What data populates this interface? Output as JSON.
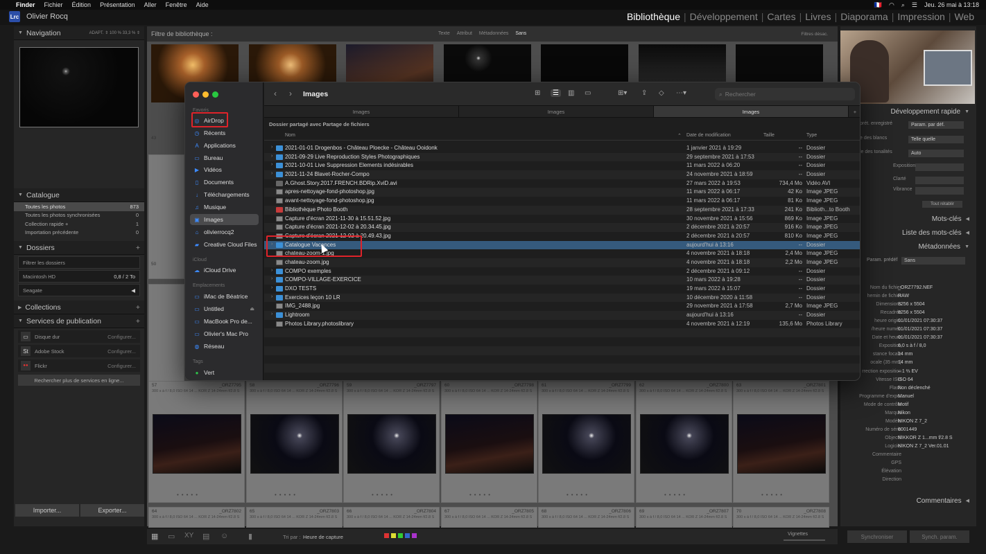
{
  "menubar": {
    "app": "Finder",
    "items": [
      "Fichier",
      "Édition",
      "Présentation",
      "Aller",
      "Fenêtre",
      "Aide"
    ],
    "flag": "🇫🇷",
    "clock": "Jeu. 26 mai à 13:18"
  },
  "lr": {
    "logo": "Lrc",
    "owner": "Olivier Rocq",
    "modules": [
      "Bibliothèque",
      "Développement",
      "Cartes",
      "Livres",
      "Diaporama",
      "Impression",
      "Web"
    ],
    "filter": {
      "title": "Filtre de bibliothèque :",
      "tabs": [
        "Texte",
        "Attribut",
        "Métadonnées",
        "Sans"
      ],
      "off": "Filtres désac."
    }
  },
  "left": {
    "navigation": {
      "title": "Navigation",
      "opts": "ADAPT. ⇕   100 %   33,3 % ⇕"
    },
    "catalogue": {
      "title": "Catalogue",
      "rows": [
        {
          "label": "Toutes les photos",
          "count": "873"
        },
        {
          "label": "Toutes les photos synchronisées",
          "count": "0"
        },
        {
          "label": "Collection rapide +",
          "count": "1"
        },
        {
          "label": "Importation précédente",
          "count": "0"
        }
      ]
    },
    "dossiers": {
      "title": "Dossiers",
      "search": "Filtrer les dossiers",
      "disks": [
        {
          "label": "Macintosh HD",
          "info": "0,8 / 2 To"
        },
        {
          "label": "Seagate",
          "info": ""
        }
      ]
    },
    "collections": {
      "title": "Collections"
    },
    "services": {
      "title": "Services de publication",
      "items": [
        {
          "icon": "▭",
          "label": "Disque dur",
          "cfg": "Configurer..."
        },
        {
          "icon": "St",
          "label": "Adobe Stock",
          "cfg": "Configurer..."
        },
        {
          "icon": "●●",
          "label": "Flickr",
          "cfg": "Configurer..."
        }
      ],
      "more": "Rechercher plus de services en ligne..."
    },
    "import_label": "Importer...",
    "export_label": "Exporter..."
  },
  "grid": {
    "row1_num": [
      "43",
      "",
      "",
      "",
      "",
      "",
      ""
    ],
    "row2": [
      {
        "num": "57",
        "file": "_ORZ7795"
      },
      {
        "num": "58",
        "file": "_ORZ7796"
      },
      {
        "num": "59",
        "file": "_ORZ7797"
      },
      {
        "num": "60",
        "file": "_ORZ7798"
      },
      {
        "num": "61",
        "file": "_ORZ7799"
      },
      {
        "num": "62",
        "file": "_ORZ7800"
      },
      {
        "num": "63",
        "file": "_ORZ7801"
      }
    ],
    "row3": [
      {
        "num": "64",
        "file": "_ORZ7802"
      },
      {
        "num": "65",
        "file": "_ORZ7803"
      },
      {
        "num": "66",
        "file": "_ORZ7804"
      },
      {
        "num": "67",
        "file": "_ORZ7805"
      },
      {
        "num": "68",
        "file": "_ORZ7806"
      },
      {
        "num": "69",
        "file": "_ORZ7807"
      },
      {
        "num": "70",
        "file": "_ORZ7808"
      }
    ],
    "meta": "300 s à f / 8,0 ISO 64  14 ... KOR Z 14-24mm f/2.8 S",
    "side_nums": [
      "50"
    ],
    "sort_label": "Tri par :",
    "sort_value": "Heure de capture",
    "vignettes": "Vignettes"
  },
  "right": {
    "quick": {
      "title": "Développement rapide",
      "rows": [
        {
          "k": "prét. enregistré",
          "v": "Param. par déf."
        },
        {
          "k": "e des blancs",
          "v": "Telle quelle"
        },
        {
          "k": "le des tonalités",
          "v": "Auto"
        },
        {
          "k": "Exposition",
          "v": ""
        },
        {
          "k": "Clarté",
          "v": ""
        },
        {
          "k": "Vibrance",
          "v": ""
        }
      ],
      "auto": "Tout rétablir"
    },
    "keywords": "Mots-clés",
    "keyword_list": "Liste des mots-clés",
    "metadata": {
      "title": "Métadonnées",
      "preset_label": "Param. prédéf",
      "preset": "Sans",
      "rows": [
        {
          "k": "Nom du fichier",
          "v": "_ORZ7792.NEF"
        },
        {
          "k": "hemin de fichier",
          "v": "RAW"
        },
        {
          "k": "Dimensions",
          "v": "8256 x 5504"
        },
        {
          "k": "Recadrée",
          "v": "8256 x 5504"
        },
        {
          "k": "heure origin.",
          "v": "01/01/2021 07:30:37"
        },
        {
          "k": "/heure numér.",
          "v": "01/01/2021 07:30:37"
        },
        {
          "k": "Date et heure",
          "v": "01/01/2021 07:30:37"
        },
        {
          "k": "Exposition",
          "v": "6,0 s à f / 8,0"
        },
        {
          "k": "stance focale",
          "v": "14 mm"
        },
        {
          "k": "ocale (35 mm)",
          "v": "14 mm"
        },
        {
          "k": "rrection exposition",
          "v": "– 1 ⅔ EV"
        },
        {
          "k": "Vitesse ISO",
          "v": "ISO 64"
        },
        {
          "k": "Flash",
          "v": "Non déclenché"
        },
        {
          "k": "Programme d'expo.",
          "v": "Manuel"
        },
        {
          "k": "Mode de contrôle",
          "v": "Motif"
        },
        {
          "k": "Marque",
          "v": "Nikon"
        },
        {
          "k": "Modèle",
          "v": "NIKON Z 7_2"
        },
        {
          "k": "Numéro de série",
          "v": "6001449"
        },
        {
          "k": "Objectif",
          "v": "NIKKOR Z 1...mm f/2.8 S"
        },
        {
          "k": "Logiciel",
          "v": "NIKON Z 7_2 Ver.01.01"
        },
        {
          "k": "Commentaire",
          "v": ""
        },
        {
          "k": "GPS",
          "v": ""
        },
        {
          "k": "Élévation",
          "v": ""
        },
        {
          "k": "Direction",
          "v": ""
        }
      ]
    },
    "comments": "Commentaires",
    "sync": "Synchroniser",
    "sync_params": "Synch. param."
  },
  "finder": {
    "title": "Images",
    "search_placeholder": "Rechercher",
    "tabs": [
      "Images",
      "Images",
      "Images"
    ],
    "shared": "Dossier partagé avec Partage de fichiers",
    "columns": {
      "name": "Nom",
      "date": "Date de modification",
      "size": "Taille",
      "kind": "Type"
    },
    "sidebar": {
      "favorites_label": "Favoris",
      "favorites": [
        {
          "icon": "◎",
          "label": "AirDrop"
        },
        {
          "icon": "◷",
          "label": "Récents"
        },
        {
          "icon": "A",
          "label": "Applications"
        },
        {
          "icon": "▭",
          "label": "Bureau"
        },
        {
          "icon": "▶",
          "label": "Vidéos"
        },
        {
          "icon": "▯",
          "label": "Documents"
        },
        {
          "icon": "↓",
          "label": "Téléchargements"
        },
        {
          "icon": "♫",
          "label": "Musique"
        },
        {
          "icon": "▣",
          "label": "Images"
        },
        {
          "icon": "⌂",
          "label": "olivierrocq2"
        },
        {
          "icon": "▰",
          "label": "Creative Cloud Files"
        }
      ],
      "icloud_label": "iCloud",
      "icloud": [
        {
          "icon": "☁",
          "label": "iCloud Drive"
        }
      ],
      "locations_label": "Emplacements",
      "locations": [
        {
          "icon": "▭",
          "label": "iMac de Béatrice"
        },
        {
          "icon": "▭",
          "label": "Untitled",
          "eject": "⏏"
        },
        {
          "icon": "▭",
          "label": "MacBook Pro de..."
        },
        {
          "icon": "▭",
          "label": "Olivier's Mac Pro"
        },
        {
          "icon": "◍",
          "label": "Réseau"
        }
      ],
      "tags_label": "Tags",
      "tags": [
        {
          "icon": "●",
          "label": "Vert"
        }
      ]
    },
    "files": [
      {
        "name": "2021-01-01 Drogenbos - Château Ploecke - Château Ooidonk",
        "date": "1 janvier 2021 à 19:29",
        "size": "--",
        "kind": "Dossier",
        "type": "dir"
      },
      {
        "name": "2021-09-29 Live Reproduction Styles Photographiques",
        "date": "29 septembre 2021 à 17:53",
        "size": "--",
        "kind": "Dossier",
        "type": "dir"
      },
      {
        "name": "2021-10-01 Live Suppression Elements indésirables",
        "date": "11 mars 2022 à 06:20",
        "size": "--",
        "kind": "Dossier",
        "type": "dir"
      },
      {
        "name": "2021-11-24 Blavet-Rocher-Compo",
        "date": "24 novembre 2021 à 18:59",
        "size": "--",
        "kind": "Dossier",
        "type": "dir"
      },
      {
        "name": "A.Ghost.Story.2017.FRENCH.BDRip.XviD.avi",
        "date": "27 mars 2022 à 19:53",
        "size": "734,4 Mo",
        "kind": "Vidéo AVI",
        "type": "vid"
      },
      {
        "name": "apres-nettoyage-fond-photoshop.jpg",
        "date": "11 mars 2022 à 06:17",
        "size": "42 Ko",
        "kind": "Image JPEG",
        "type": "img"
      },
      {
        "name": "avant-nettoyage-fond-photoshop.jpg",
        "date": "11 mars 2022 à 06:17",
        "size": "81 Ko",
        "kind": "Image JPEG",
        "type": "img"
      },
      {
        "name": "Bibliothèque Photo Booth",
        "date": "28 septembre 2021 à 17:33",
        "size": "241 Ko",
        "kind": "Biblioth...to Booth",
        "type": "app"
      },
      {
        "name": "Capture d'écran 2021-11-30 à 15.51.52.jpg",
        "date": "30 novembre 2021 à 15:56",
        "size": "869 Ko",
        "kind": "Image JPEG",
        "type": "img"
      },
      {
        "name": "Capture d'écran 2021-12-02 à 20.34.45.jpg",
        "date": "2 décembre 2021 à 20:57",
        "size": "916 Ko",
        "kind": "Image JPEG",
        "type": "img"
      },
      {
        "name": "Capture d'écran 2021-12-02 à 20.49.43.jpg",
        "date": "2 décembre 2021 à 20:57",
        "size": "810 Ko",
        "kind": "Image JPEG",
        "type": "img"
      },
      {
        "name": "Catalogue Vacances",
        "date": "aujourd'hui à 13:16",
        "size": "--",
        "kind": "Dossier",
        "type": "dir",
        "selected": true
      },
      {
        "name": "chateau-zoom-1.jpg",
        "date": "4 novembre 2021 à 18:18",
        "size": "2,4 Mo",
        "kind": "Image JPEG",
        "type": "img"
      },
      {
        "name": "chateau-zoom.jpg",
        "date": "4 novembre 2021 à 18:18",
        "size": "2,2 Mo",
        "kind": "Image JPEG",
        "type": "img"
      },
      {
        "name": "COMPO exemples",
        "date": "2 décembre 2021 à 09:12",
        "size": "--",
        "kind": "Dossier",
        "type": "dir"
      },
      {
        "name": "COMPO-VILLAGE-EXERCICE",
        "date": "10 mars 2022 à 19:28",
        "size": "--",
        "kind": "Dossier",
        "type": "dir"
      },
      {
        "name": "DXO TESTS",
        "date": "19 mars 2022 à 15:07",
        "size": "--",
        "kind": "Dossier",
        "type": "dir"
      },
      {
        "name": "Exercices leçon 10 LR",
        "date": "10 décembre 2020 à 11:58",
        "size": "--",
        "kind": "Dossier",
        "type": "dir"
      },
      {
        "name": "IMG_2488.jpg",
        "date": "29 novembre 2021 à 17:58",
        "size": "2,7 Mo",
        "kind": "Image JPEG",
        "type": "img"
      },
      {
        "name": "Lightroom",
        "date": "aujourd'hui à 13:16",
        "size": "--",
        "kind": "Dossier",
        "type": "dir"
      },
      {
        "name": "Photos Library.photoslibrary",
        "date": "4 novembre 2021 à 12:19",
        "size": "135,6 Mo",
        "kind": "Photos Library",
        "type": "img"
      }
    ]
  },
  "colors": {
    "accent": "#3c90d7",
    "selection": "#355a7d",
    "highlight": "#e0232a"
  }
}
